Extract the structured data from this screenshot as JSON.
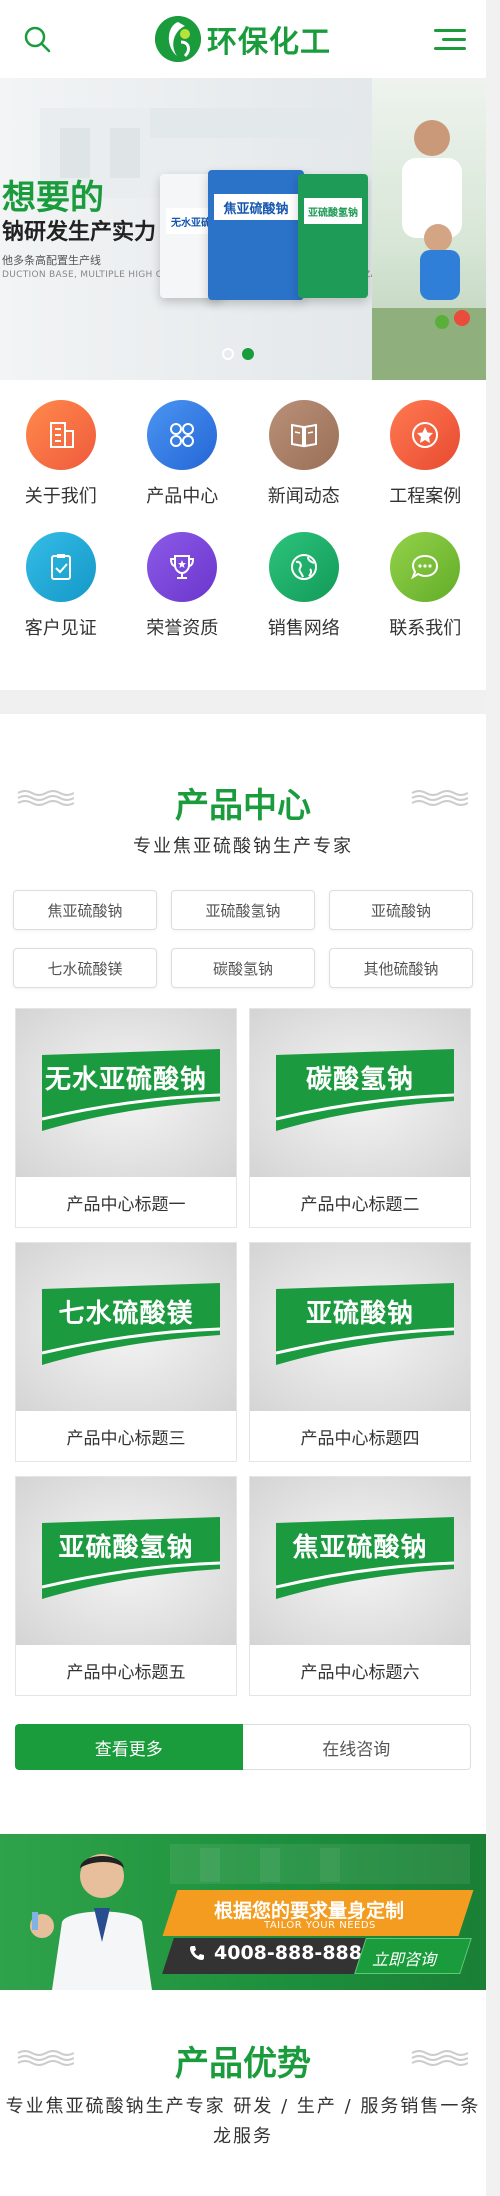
{
  "header": {
    "logo_text": "环保化工",
    "brand_color": "#1a9c3c"
  },
  "banner": {
    "headline": "想要的",
    "subline": "钠研发生产实力",
    "small_line": "他多条高配置生产线",
    "tiny_line": "DUCTION BASE, MULTIPLE HIGH CONFIGU... PROVIDE ON-DEMAND CUSTOMIZATION.",
    "bag_labels": [
      "无水亚硫",
      "焦亚硫酸钠",
      "亚硫酸氢钠"
    ],
    "slides": 2,
    "active_slide": 2
  },
  "quicknav": [
    {
      "label": "关于我们",
      "icon": "building-icon",
      "color": "#f26b3a"
    },
    {
      "label": "产品中心",
      "icon": "grid-icon",
      "color": "#2f7fe8"
    },
    {
      "label": "新闻动态",
      "icon": "book-icon",
      "color": "#a77d63"
    },
    {
      "label": "工程案例",
      "icon": "star-icon",
      "color": "#ef5a3c"
    },
    {
      "label": "客户见证",
      "icon": "clipboard-check-icon",
      "color": "#1aa7d6"
    },
    {
      "label": "荣誉资质",
      "icon": "trophy-icon",
      "color": "#7a45d8"
    },
    {
      "label": "销售网络",
      "icon": "globe-icon",
      "color": "#1fae6a"
    },
    {
      "label": "联系我们",
      "icon": "chat-icon",
      "color": "#7dc23a"
    }
  ],
  "products": {
    "title": "产品中心",
    "subtitle": "专业焦亚硫酸钠生产专家",
    "tags": [
      "焦亚硫酸钠",
      "亚硫酸氢钠",
      "亚硫酸钠",
      "七水硫酸镁",
      "碳酸氢钠",
      "其他硫酸钠"
    ],
    "items": [
      {
        "image_text": "无水亚硫酸钠",
        "caption": "产品中心标题一"
      },
      {
        "image_text": "碳酸氢钠",
        "caption": "产品中心标题二"
      },
      {
        "image_text": "七水硫酸镁",
        "caption": "产品中心标题三"
      },
      {
        "image_text": "亚硫酸钠",
        "caption": "产品中心标题四"
      },
      {
        "image_text": "亚硫酸氢钠",
        "caption": "产品中心标题五"
      },
      {
        "image_text": "焦亚硫酸钠",
        "caption": "产品中心标题六"
      }
    ],
    "more_label": "查看更多",
    "consult_label": "在线咨询"
  },
  "cta": {
    "title": "根据您的要求量身定制",
    "subtitle": "TAILOR YOUR NEEDS",
    "phone": "4008-888-888",
    "button": "立即咨询"
  },
  "advantages": {
    "title": "产品优势",
    "subtitle": "专业焦亚硫酸钠生产专家 研发 / 生产 / 服务销售一条龙服务"
  }
}
